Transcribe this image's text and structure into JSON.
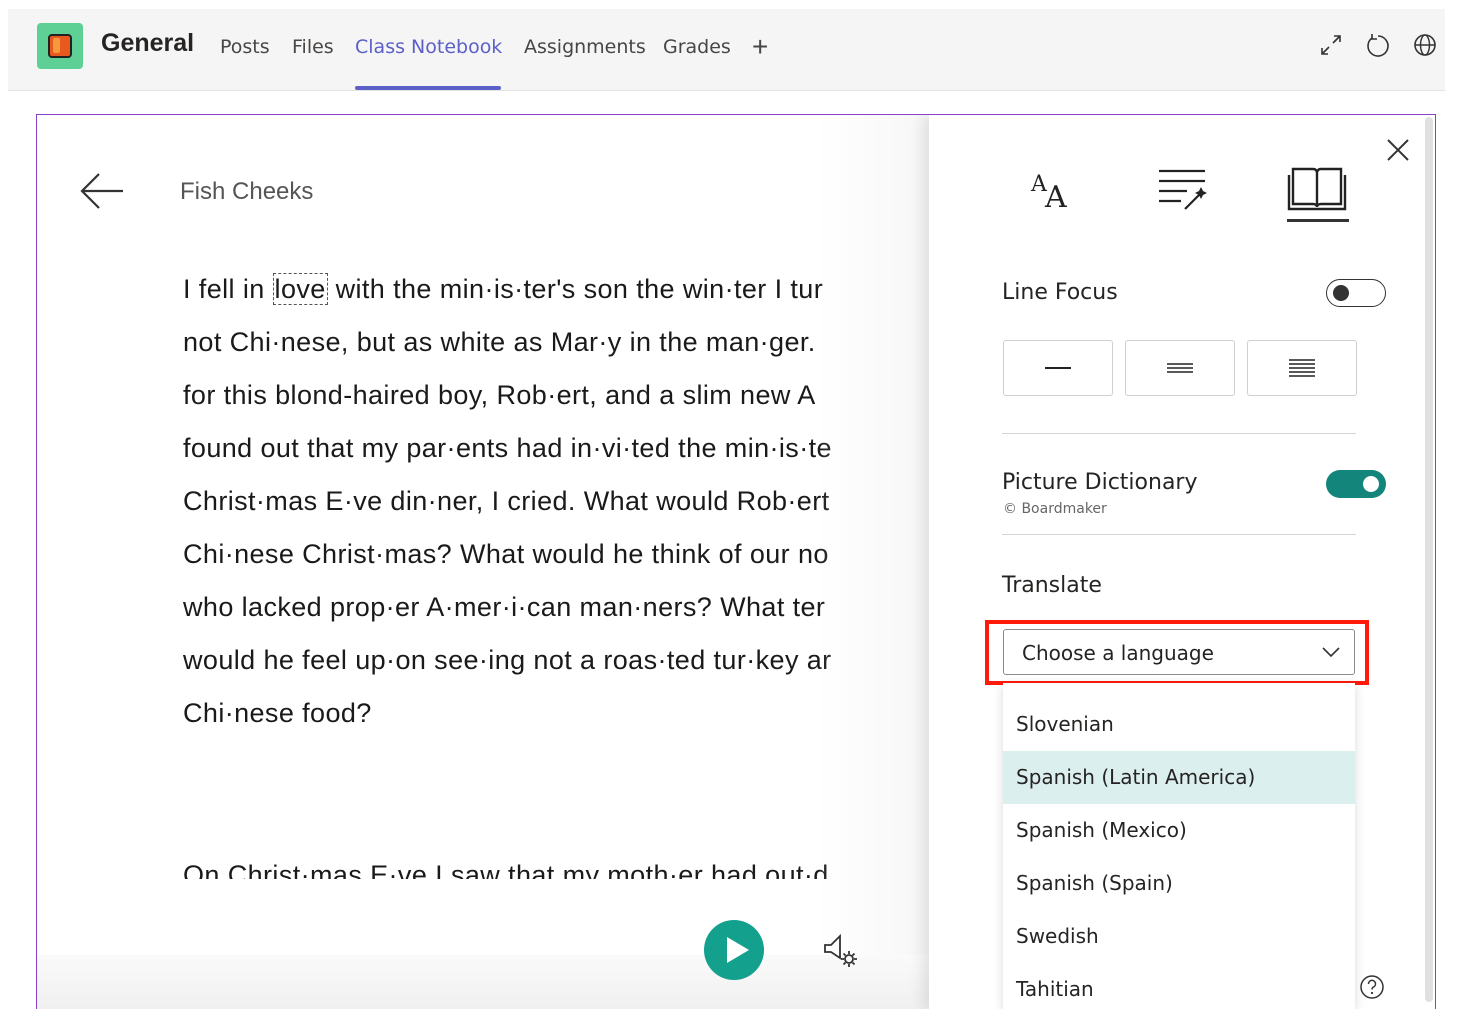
{
  "header": {
    "channel_title": "General",
    "tabs": [
      {
        "label": "Posts"
      },
      {
        "label": "Files"
      },
      {
        "label": "Class Notebook"
      },
      {
        "label": "Assignments"
      },
      {
        "label": "Grades"
      }
    ],
    "add_tab_label": "+",
    "active_tab": "Class Notebook",
    "accent_color": "#5b5fc7",
    "right_icons": [
      "expand-icon",
      "refresh-icon",
      "globe-icon"
    ]
  },
  "reader": {
    "doc_title": "Fish Cheeks",
    "focused_word": "love",
    "lines": [
      {
        "before": "I fell in ",
        "after": " with the min·is·ter's son the win·ter I tur"
      },
      {
        "text": "not Chi·nese, but as white as Mar·y in the man·ger."
      },
      {
        "text": "for this blond-haired boy, Rob·ert, and a slim new A"
      },
      {
        "text": "found out that my par·ents had in·vi·ted the min·is·te"
      },
      {
        "text": "Christ·mas E·ve din·ner, I cried. What would Rob·ert"
      },
      {
        "text": "Chi·nese Christ·mas? What would he think of our no"
      },
      {
        "text": "who lacked prop·er A·mer·i·can man·ners? What ter"
      },
      {
        "text": "would he feel up·on see·ing not a roas·ted tur·key ar"
      },
      {
        "text": "Chi·nese food?"
      }
    ],
    "next_paragraph": "On Christ·mas E·ve I saw that my moth·er had out·d",
    "play_color": "#13a08c"
  },
  "panel": {
    "line_focus_label": "Line Focus",
    "line_focus_on": false,
    "picture_dictionary_label": "Picture Dictionary",
    "picture_dictionary_credit": "© Boardmaker",
    "picture_dictionary_on": true,
    "translate_label": "Translate",
    "language_placeholder": "Choose a language",
    "languages": [
      "Slovenian",
      "Spanish (Latin America)",
      "Spanish (Mexico)",
      "Spanish (Spain)",
      "Swedish",
      "Tahitian"
    ],
    "hovered_language": "Spanish (Latin America)",
    "toggle_on_color": "#13857a",
    "highlight_color": "#ff1a0a"
  }
}
